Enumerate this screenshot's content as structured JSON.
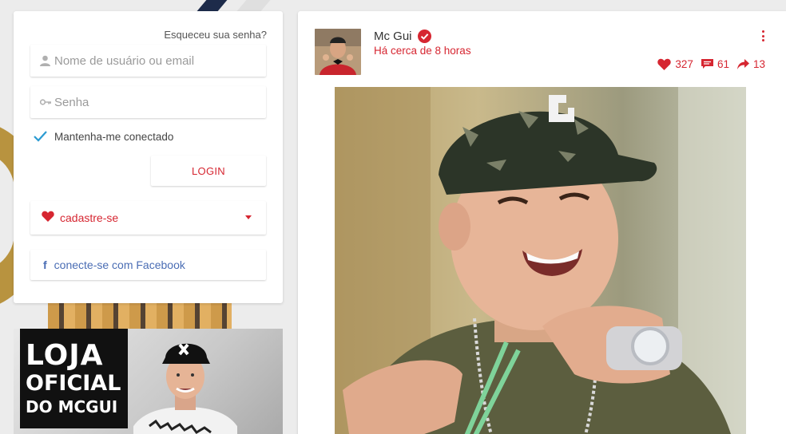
{
  "login": {
    "forgot_label": "Esqueceu sua senha?",
    "username_placeholder": "Nome de usuário ou email",
    "password_placeholder": "Senha",
    "remember_label": "Mantenha-me conectado",
    "remember_checked": true,
    "login_label": "LOGIN",
    "signup_label": "cadastre-se",
    "facebook_label": "conecte-se com Facebook"
  },
  "store": {
    "line1": "LOJA",
    "line2": "OFICIAL",
    "line3": "DO MCGUI"
  },
  "post": {
    "author": "Mc Gui",
    "verified": true,
    "time": "Há cerca de 8 horas",
    "likes": "327",
    "comments": "61",
    "shares": "13"
  },
  "icons": {
    "user": "user-icon",
    "key": "key-icon",
    "heart": "heart-icon",
    "facebook": "facebook-icon",
    "verified": "verified-badge-icon",
    "comment": "comment-icon",
    "share": "share-icon",
    "menu": "more-vertical-icon"
  },
  "colors": {
    "accent": "#d62631",
    "facebook": "#4a6db4",
    "check": "#2b9bd2"
  }
}
